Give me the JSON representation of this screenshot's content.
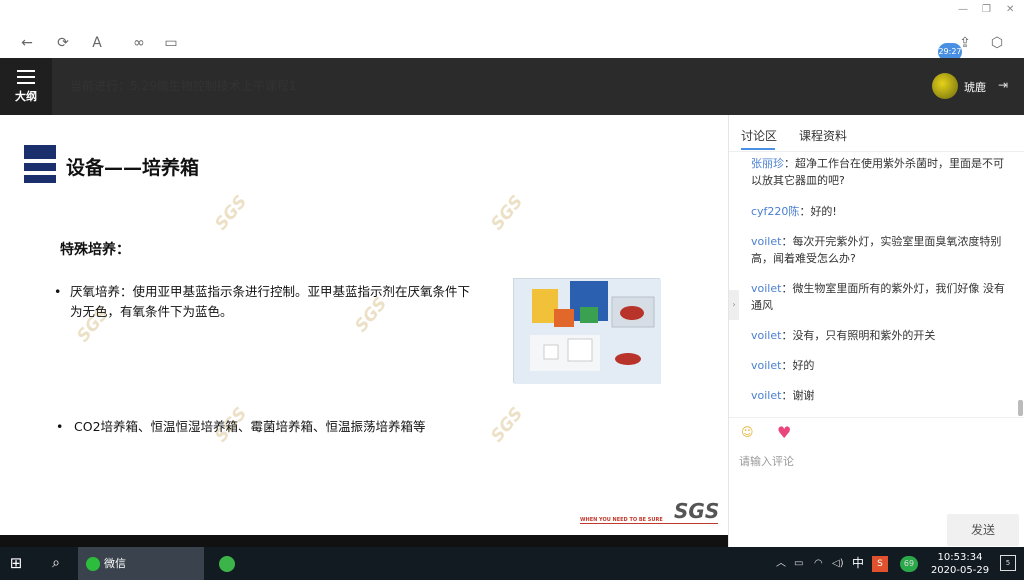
{
  "timer_badge": "29:27",
  "header": {
    "outline_label": "大纲",
    "course_title": "当前进行：5.29微生物控制技术上午课程1",
    "username": "琥鹿"
  },
  "slide": {
    "title": "设备——培养箱",
    "section_label": "特殊培养：",
    "bullet1": "厌氧培养：使用亚甲基蓝指示条进行控制。亚甲基蓝指示剂在厌氧条件下为无色，有氧条件下为蓝色。",
    "bullet2": "CO2培养箱、恒温恒湿培养箱、霉菌培养箱、恒温振荡培养箱等",
    "watermark": "SGS",
    "footer_tagline": "WHEN YOU NEED TO BE SURE",
    "footer_logo": "SGS"
  },
  "panel": {
    "tabs": [
      "讨论区",
      "课程资料"
    ],
    "messages": [
      {
        "name": "张丽珍",
        "text": "超净工作台在使用紫外杀菌时，里面是不可以放其它器皿的吧?"
      },
      {
        "name": "cyf220陈",
        "text": "好的!"
      },
      {
        "name": "voilet",
        "text": "每次开完紫外灯，实验室里面臭氧浓度特别高，闻着难受怎么办?"
      },
      {
        "name": "voilet",
        "text": "微生物室里面所有的紫外灯，我们好像 没有通风"
      },
      {
        "name": "voilet",
        "text": "没有，只有照明和紫外的开关"
      },
      {
        "name": "voilet",
        "text": "好的"
      },
      {
        "name": "voilet",
        "text": "谢谢"
      }
    ],
    "input_placeholder": "请输入评论",
    "send_label": "发送"
  },
  "taskbar": {
    "wechat_label": "微信",
    "ime": "中",
    "badge": "69",
    "time": "10:53:34",
    "date": "2020-05-29",
    "notif_count": "5"
  }
}
